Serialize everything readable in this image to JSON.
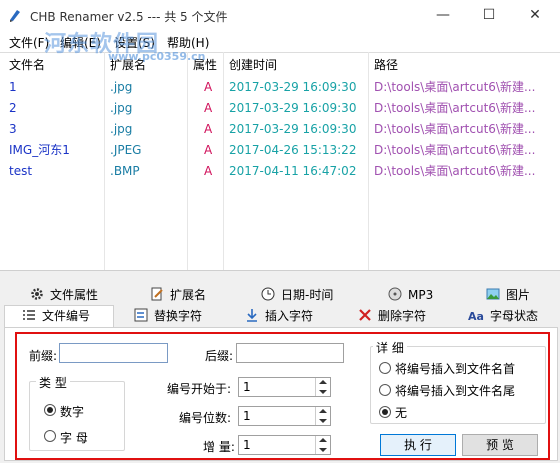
{
  "window": {
    "title": "CHB Renamer v2.5 --- 共 5 个文件",
    "minimize_glyph": "—",
    "maximize_glyph": "☐",
    "close_glyph": "✕"
  },
  "watermark": {
    "line1": "河东软件园",
    "line2": "www.pc0359.cn"
  },
  "menu": [
    "文件(F)",
    "编辑(E)",
    "设置(S)",
    "帮助(H)"
  ],
  "list": {
    "columns": [
      "文件名",
      "扩展名",
      "属性",
      "创建时间",
      "路径"
    ],
    "rows": [
      {
        "name": "1",
        "ext": ".jpg",
        "attr": "A",
        "created": "2017-03-29 16:09:30",
        "path": "D:\\tools\\桌面\\artcut6\\新建..."
      },
      {
        "name": "2",
        "ext": ".jpg",
        "attr": "A",
        "created": "2017-03-29 16:09:30",
        "path": "D:\\tools\\桌面\\artcut6\\新建..."
      },
      {
        "name": "3",
        "ext": ".jpg",
        "attr": "A",
        "created": "2017-03-29 16:09:30",
        "path": "D:\\tools\\桌面\\artcut6\\新建..."
      },
      {
        "name": "IMG_河东1",
        "ext": ".JPEG",
        "attr": "A",
        "created": "2017-04-26 15:13:22",
        "path": "D:\\tools\\桌面\\artcut6\\新建..."
      },
      {
        "name": "test",
        "ext": ".BMP",
        "attr": "A",
        "created": "2017-04-11 16:47:02",
        "path": "D:\\tools\\桌面\\artcut6\\新建..."
      }
    ]
  },
  "tabs_row1": [
    {
      "label": "文件属性",
      "icon": "gear-icon"
    },
    {
      "label": "扩展名",
      "icon": "document-edit-icon"
    },
    {
      "label": "日期-时间",
      "icon": "clock-icon"
    },
    {
      "label": "MP3",
      "icon": "cd-icon"
    },
    {
      "label": "图片",
      "icon": "picture-icon"
    }
  ],
  "tabs_row2": [
    {
      "label": "文件编号",
      "icon": "numbered-list-icon"
    },
    {
      "label": "替换字符",
      "icon": "replace-icon"
    },
    {
      "label": "插入字符",
      "icon": "insert-icon"
    },
    {
      "label": "删除字符",
      "icon": "delete-x-icon"
    },
    {
      "label": "字母状态",
      "icon": "letter-case-icon"
    }
  ],
  "panel": {
    "prefix_label": "前缀:",
    "prefix_value": "",
    "suffix_label": "后缀:",
    "suffix_value": "",
    "type_group": {
      "title": "类 型",
      "options": [
        "数字",
        "字 母"
      ],
      "selected": 0
    },
    "start_label": "编号开始于:",
    "start_value": "1",
    "digits_label": "编号位数:",
    "digits_value": "1",
    "step_label": "增 量:",
    "step_value": "1",
    "detail_group": {
      "title": "详 细",
      "options": [
        "将编号插入到文件名首",
        "将编号插入到文件名尾",
        "无"
      ],
      "selected": 2
    },
    "execute_label": "执 行",
    "preview_label": "预 览"
  },
  "colors": {
    "highlight_border": "#e01010",
    "name_col": "#1a33c6",
    "attr_col": "#d0105a",
    "time_col": "#18a2a6",
    "path_col": "#a050b0"
  }
}
